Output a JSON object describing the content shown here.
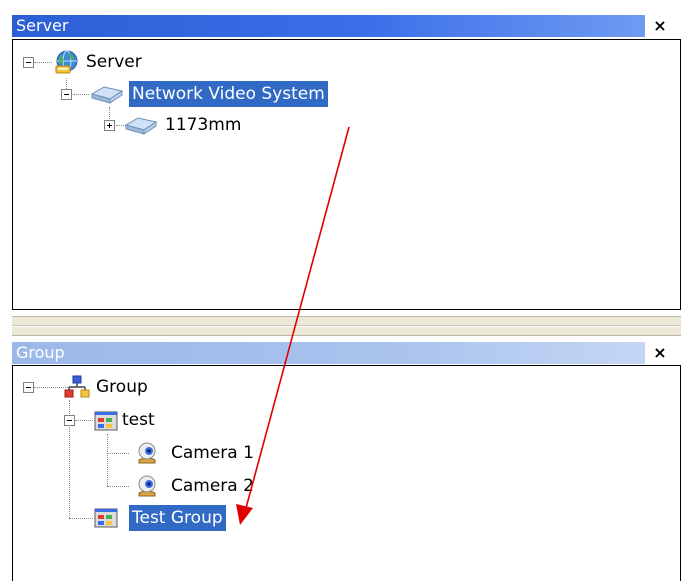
{
  "server_panel": {
    "title": "Server",
    "close_glyph": "×",
    "nodes": [
      {
        "label": "Server",
        "icon": "server-globe-icon",
        "expander": "minus"
      },
      {
        "label": "Network Video System",
        "icon": "network-device-icon",
        "expander": "minus",
        "selected": true
      },
      {
        "label": "1173mm",
        "icon": "network-device-icon",
        "expander": "plus"
      }
    ]
  },
  "group_panel": {
    "title": "Group",
    "close_glyph": "×",
    "nodes": [
      {
        "label": "Group",
        "icon": "group-hierarchy-icon",
        "expander": "minus"
      },
      {
        "label": "test",
        "icon": "camera-group-icon",
        "expander": "minus"
      },
      {
        "label": "Camera 1",
        "icon": "camera-icon"
      },
      {
        "label": "Camera 2",
        "icon": "camera-icon"
      },
      {
        "label": "Test Group",
        "icon": "camera-group-icon",
        "selected": true
      }
    ]
  },
  "colors": {
    "selection": "#316ac5",
    "active_title": "#3a6ee8",
    "inactive_title": "#a9c3ee",
    "annotation_arrow": "#e00000"
  }
}
